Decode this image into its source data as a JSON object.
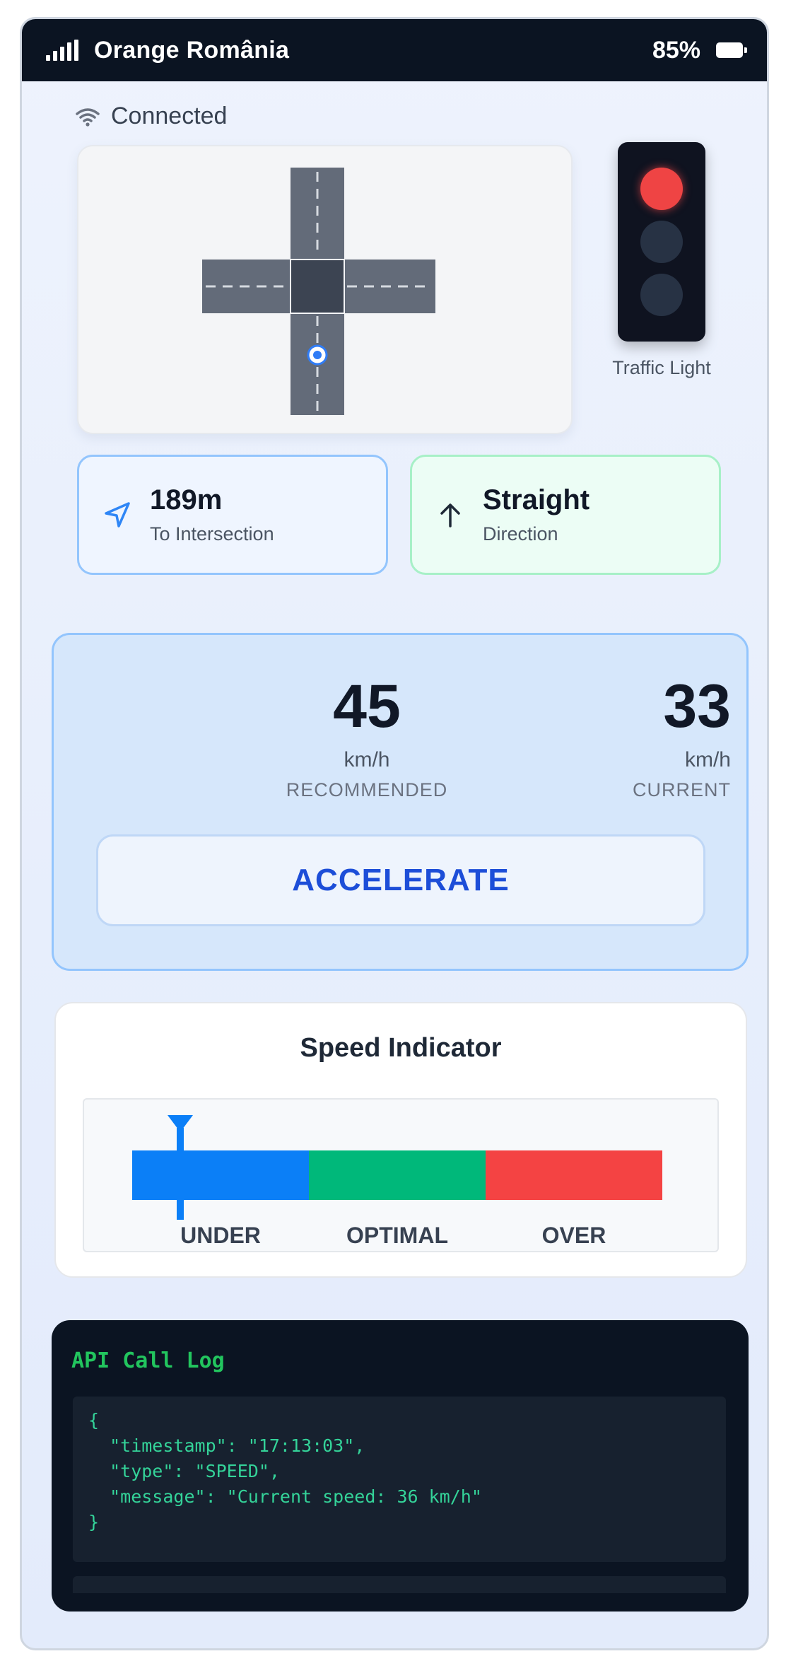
{
  "status_bar": {
    "carrier": "Orange România",
    "battery_percent": "85%",
    "icons": [
      "signal-bars-icon",
      "battery-icon"
    ]
  },
  "connection": {
    "label": "Connected",
    "icon": "wifi-icon"
  },
  "traffic_light": {
    "caption": "Traffic Light",
    "active_light": "red"
  },
  "distance": {
    "value": "189m",
    "label": "To Intersection",
    "icon": "navigation-arrow-icon"
  },
  "direction": {
    "value": "Straight",
    "label": "Direction",
    "icon": "arrow-up-icon"
  },
  "speed": {
    "recommended": {
      "value": "45",
      "unit": "km/h",
      "label": "RECOMMENDED"
    },
    "current": {
      "value": "33",
      "unit": "km/h",
      "label": "CURRENT"
    },
    "action_label": "ACCELERATE"
  },
  "indicator": {
    "title": "Speed Indicator",
    "segments": [
      {
        "label": "UNDER",
        "color": "#0b7ff7"
      },
      {
        "label": "OPTIMAL",
        "color": "#00b87a"
      },
      {
        "label": "OVER",
        "color": "#f44343"
      }
    ],
    "marker_position": 0.09
  },
  "log": {
    "title": "API Call Log",
    "lines": [
      "{",
      "  \"timestamp\": \"17:13:03\",",
      "  \"type\": \"SPEED\",",
      "  \"message\": \"Current speed: 36 km/h\"",
      "}"
    ]
  },
  "colors": {
    "accent_blue": "#1d4ed8",
    "light_red": "#ef4444",
    "log_green": "#22c55e"
  }
}
